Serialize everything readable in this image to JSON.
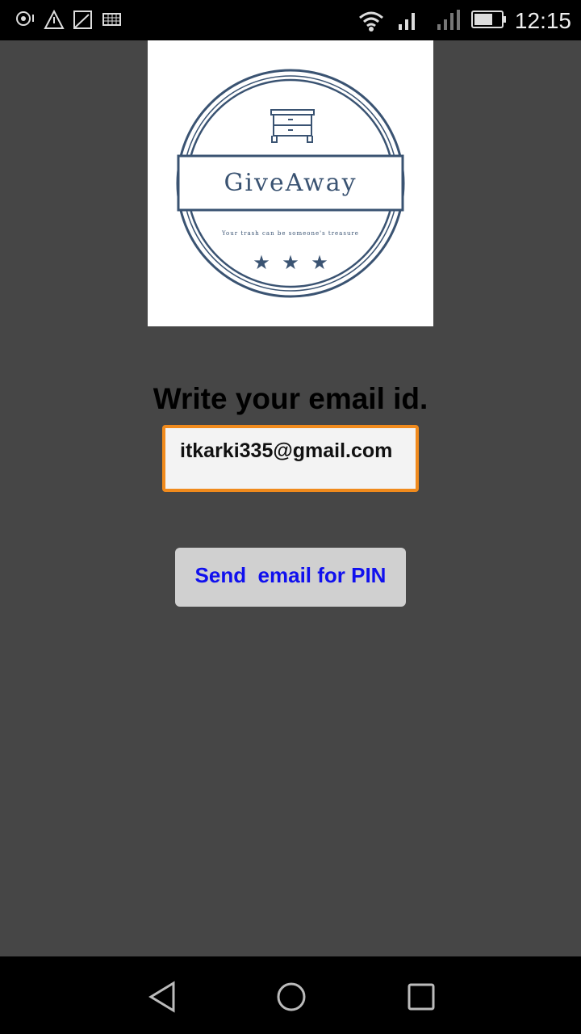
{
  "status_bar": {
    "time": "12:15",
    "icons": [
      "location-alert-icon",
      "warning-icon",
      "image-icon",
      "keyboard-icon",
      "wifi-icon",
      "signal-icon",
      "signal-weak-icon",
      "battery-icon"
    ]
  },
  "logo": {
    "brand": "GiveAway",
    "tagline": "Your trash can be someone's treasure",
    "color": "#3a5372"
  },
  "main": {
    "prompt": "Write your email id.",
    "email_value": "itkarki335@gmail.com",
    "send_button": "Send  email for PIN"
  },
  "colors": {
    "accent": "#f08a1c",
    "button_text": "#1010ee"
  }
}
